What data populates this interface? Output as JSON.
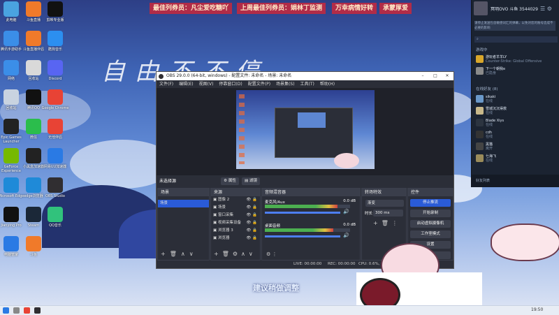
{
  "top_banners": [
    "最佳列券员：凡尘爱吃糖吖",
    "上周最佳列券员：娟林丁监测",
    "万幸病情好转",
    "承蒙厚爱"
  ],
  "desktop_icons": [
    {
      "label": "此电脑",
      "color": "#4aa3e0"
    },
    {
      "label": "斗鱼直播",
      "color": "#f07a2a"
    },
    {
      "label": "剪映专业版",
      "color": "#111"
    },
    {
      "label": "腾讯手游助手",
      "color": "#3b8ee8"
    },
    {
      "label": "斗鱼直播伴侣",
      "color": "#f07a2a"
    },
    {
      "label": "酷狗音乐",
      "color": "#2c8ff0"
    },
    {
      "label": "网络",
      "color": "#3b8ee8"
    },
    {
      "label": "回收站",
      "color": "#d9d9d9"
    },
    {
      "label": "Discord",
      "color": "#5865f2"
    },
    {
      "label": "回收站",
      "color": "#c9d3e0"
    },
    {
      "label": "腾讯QQ",
      "color": "#111"
    },
    {
      "label": "Google Chrome",
      "color": "#e84335"
    },
    {
      "label": "Epic Games Launcher",
      "color": "#222"
    },
    {
      "label": "微信",
      "color": "#2bbd4c"
    },
    {
      "label": "无他伴侣",
      "color": "#e84335"
    },
    {
      "label": "GeForce Experience",
      "color": "#76b900"
    },
    {
      "label": "小黑盒加速器",
      "color": "#222"
    },
    {
      "label": "网易UU加速器",
      "color": "#2a7ae4"
    },
    {
      "label": "Microsoft Edge",
      "color": "#1f8ad8"
    },
    {
      "label": "edge浏览器",
      "color": "#1f8ad8"
    },
    {
      "label": "OBS Studio",
      "color": "#302e31"
    },
    {
      "label": "Jianying Pro",
      "color": "#111"
    },
    {
      "label": "Steam",
      "color": "#1b2838"
    },
    {
      "label": "QQ音乐",
      "color": "#31c27c"
    },
    {
      "label": "电脑管家",
      "color": "#2a7ae4"
    },
    {
      "label": "斗鱼",
      "color": "#f07a2a"
    }
  ],
  "calligraphy": "自由不不停",
  "obs": {
    "title": "OBS 29.0.0 (64-bit, windows) - 配置文件: 未命名 - 场景: 未命名",
    "menu": [
      "文件(F)",
      "编辑(E)",
      "视图(V)",
      "停靠窗口(D)",
      "配置文件(P)",
      "场景集(S)",
      "工具(T)",
      "帮助(H)"
    ],
    "source_none": "未选择源",
    "props_btn": "属性",
    "filters_btn": "滤镜",
    "docks": {
      "scenes": {
        "title": "场景",
        "items": [
          "场景"
        ]
      },
      "sources": {
        "title": "来源",
        "items": [
          "图像 2",
          "场景",
          "窗口采集",
          "视频采集设备",
          "浏览器 3",
          "浏览器"
        ]
      },
      "mixer": {
        "title": "音频混音器",
        "tracks": [
          {
            "name": "麦克风/Aux",
            "db": "0.0 dB",
            "level": 0.85
          },
          {
            "name": "桌面音频",
            "db": "0.0 dB",
            "level": 0.8
          }
        ]
      },
      "transitions": {
        "title": "转场特效",
        "type": "渐变",
        "duration_label": "时长",
        "duration": "300 ms"
      },
      "controls": {
        "title": "控件",
        "buttons": [
          "停止推流",
          "开始录制",
          "启动虚拟摄像机",
          "工作室模式",
          "设置",
          "退出"
        ]
      }
    },
    "status": {
      "live": "LIVE: 00:00:00",
      "rec": "REC: 00:00:00",
      "cpu": "CPU: 0.6%, 30.00 fps"
    }
  },
  "chat": {
    "user_name": "冥明OVO",
    "user_id": "斗鱼 3544029",
    "notice": "请停止发送包含敏感词汇的弹幕，以免对您的账号造成不必要的影响",
    "section_playing": "游戏中",
    "section_online": "在线好友 (8)",
    "playing": [
      {
        "name": "游玩者羊羊LY",
        "status": "Counter-Strike: Global Offensive",
        "color": "#d8a62a"
      },
      {
        "name": "下一个朝我e",
        "status": "已隐身",
        "color": "#8a8a8a"
      }
    ],
    "friends": [
      {
        "name": "sikaki",
        "status": "在线",
        "color": "#6a98c9"
      },
      {
        "name": "雪城沉沉得救",
        "status": "在线",
        "color": "#c8b88a"
      },
      {
        "name": "Blade Xiys",
        "status": "在线",
        "color": "#2c3440"
      },
      {
        "name": "cdh",
        "status": "在线",
        "color": "#333"
      },
      {
        "name": "黑猫",
        "status": "离开",
        "color": "#444"
      },
      {
        "name": "七海飞",
        "status": "在线",
        "color": "#9a8b5a"
      }
    ],
    "footer": "好友列表"
  },
  "subtitle": "建议稍做调整",
  "taskbar": {
    "time": "19:50"
  },
  "accent": "#2a5bd7"
}
